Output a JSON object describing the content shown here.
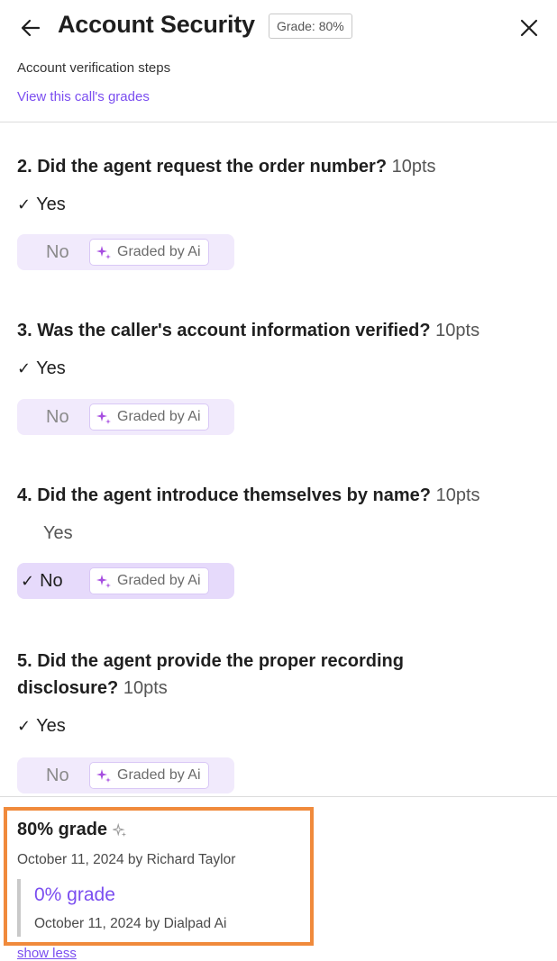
{
  "header": {
    "title": "Account Security",
    "grade_badge": "Grade: 80%",
    "subtitle": "Account verification steps",
    "grades_link": "View this call's grades"
  },
  "questions": [
    {
      "title": "2. Did the agent request the order number?",
      "points": "10pts",
      "yes_label": "Yes",
      "no_label": "No",
      "selected": "Yes",
      "ai_tag": "Graded by Ai"
    },
    {
      "title": "3. Was the caller's account information verified?",
      "points": "10pts",
      "yes_label": "Yes",
      "no_label": "No",
      "selected": "Yes",
      "ai_tag": "Graded by Ai"
    },
    {
      "title": "4. Did the agent introduce themselves by name?",
      "points": "10pts",
      "yes_label": "Yes",
      "no_label": "No",
      "selected": "No",
      "ai_tag": "Graded by Ai"
    },
    {
      "title_line1": "5. Did the agent provide the proper recording",
      "title_line2": "disclosure?",
      "points": "10pts",
      "yes_label": "Yes",
      "no_label": "No",
      "selected": "Yes",
      "ai_tag": "Graded by Ai"
    }
  ],
  "grades": {
    "current": {
      "label": "80% grade",
      "meta": "October 11, 2024 by Richard Taylor"
    },
    "previous": {
      "label": "0% grade",
      "meta": "October 11, 2024 by Dialpad Ai"
    },
    "show_less": "show less"
  },
  "icons": {
    "back": "arrow-left-icon",
    "close": "close-icon",
    "check": "checkmark-icon",
    "ai": "sparkle-icon"
  },
  "colors": {
    "accent": "#7b4ef0",
    "highlight_border": "#f08a3c",
    "pill": "#f1eafc"
  }
}
